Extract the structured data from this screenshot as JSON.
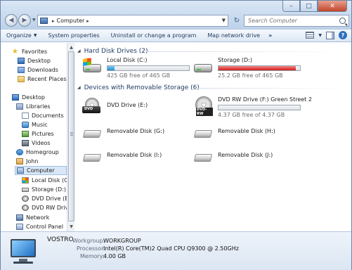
{
  "window": {
    "controls": {
      "minimize": "–",
      "maximize": "□",
      "close": "✕"
    }
  },
  "address": {
    "crumb": "Computer",
    "separator": "▸"
  },
  "search": {
    "placeholder": "Search Computer"
  },
  "toolbar": {
    "organize": "Organize",
    "system_properties": "System properties",
    "uninstall": "Uninstall or change a program",
    "map_drive": "Map network drive",
    "more": "»"
  },
  "nav": {
    "favorites": "Favorites",
    "desktop_fav": "Desktop",
    "downloads": "Downloads",
    "recent": "Recent Places",
    "desktop": "Desktop",
    "libraries": "Libraries",
    "documents": "Documents",
    "music": "Music",
    "pictures": "Pictures",
    "videos": "Videos",
    "homegroup": "Homegroup",
    "john": "John",
    "computer": "Computer",
    "local_disk": "Local Disk (C:)",
    "storage": "Storage (D:)",
    "dvd_e": "DVD Drive (E:)",
    "dvd_rw": "DVD RW Drive (",
    "network": "Network",
    "control_panel": "Control Panel"
  },
  "groups": {
    "hdd": "Hard Disk Drives (2)",
    "removable": "Devices with Removable Storage (6)"
  },
  "drives": {
    "c": {
      "name": "Local Disk (C:)",
      "free": "425 GB free of 465 GB",
      "used_fraction": 0.086
    },
    "d": {
      "name": "Storage (D:)",
      "free": "25.2 GB free of 465 GB",
      "used_fraction": 0.946
    },
    "e": {
      "name": "DVD Drive (E:)"
    },
    "f": {
      "name": "DVD RW Drive (F:) Green Street 2",
      "free": "4.37 GB free of 4.37 GB",
      "used_fraction": 0.0
    },
    "g": {
      "name": "Removable Disk (G:)"
    },
    "h": {
      "name": "Removable Disk (H:)"
    },
    "i": {
      "name": "Removable Disk (I:)"
    },
    "j": {
      "name": "Removable Disk (J:)"
    }
  },
  "details": {
    "name": "VOSTRO",
    "workgroup_label": "Workgroup:",
    "workgroup": "WORKGROUP",
    "processor_label": "Processor:",
    "processor": "Intel(R) Core(TM)2 Quad  CPU   Q9300  @ 2.50GHz",
    "memory_label": "Memory:",
    "memory": "4.00 GB"
  },
  "colors": {
    "bar_normal": "#1d8fd1",
    "bar_full": "#d11a1a",
    "group_header": "#1e3a63"
  }
}
